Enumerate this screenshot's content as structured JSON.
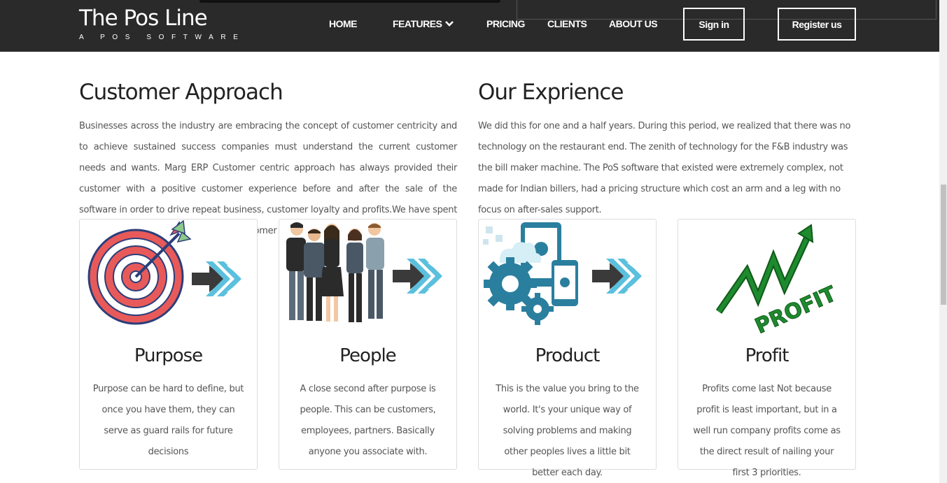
{
  "nav": {
    "logo_title": "The Pos Line",
    "logo_subtitle": "A POS SOFTWARE",
    "items": {
      "home": "HOME",
      "features": "FEATURES",
      "pricing": "PRICING",
      "clients": "CLIENTS",
      "about": "ABOUT US"
    },
    "sign_in": "Sign in",
    "register": "Register us",
    "background": "#2a2a2a"
  },
  "customer_approach": {
    "title": "Customer Approach",
    "text": "Businesses across the industry are embracing the concept of customer centricity and to achieve sustained success companies must understand the current customer needs and wants. Marg ERP Customer centric approach has always provided their customer with a positive customer experience before and after the sale of the software in order to drive repeat business, customer loyalty and profits.We have spent years creating a culture around the customer and their needs.."
  },
  "our_experience": {
    "title": "Our Exprience",
    "text": "We did this for one and a half years. During this period, we realized that there was no technology on the restaurant end. The zenith of technology for the F&B industry was the bill maker machine. The PoS software that existed were extremely complex, not made for Indian billers, had a pricing structure which cost an arm and a leg with no focus on after-sales support."
  },
  "cards": [
    {
      "title": "Purpose",
      "text": "Purpose can be hard to define, but once you have them, they can serve as guard rails for future decisions",
      "icon": "target-arrow-icon"
    },
    {
      "title": "People",
      "text": "A close second after purpose is people. This can be customers, employees, partners. Basically anyone you associate with.",
      "icon": "people-group-icon"
    },
    {
      "title": "Product",
      "text": "This is the value you bring to the world. It's your unique way of solving problems and making other peoples lives a little bit better each day.",
      "icon": "gears-devices-icon"
    },
    {
      "title": "Profit",
      "text": "Profits come last Not because profit is least important, but in a well run company profits come as the direct result of nailing your first 3 priorities.",
      "icon": "profit-chart-icon"
    }
  ],
  "profit_logo_text": "PROFIT",
  "colors": {
    "accent_blue": "#5bc0de",
    "arrow_dark": "#3a3a3a",
    "target_red": "#e85a5a",
    "profit_green": "#1e8a2e"
  }
}
